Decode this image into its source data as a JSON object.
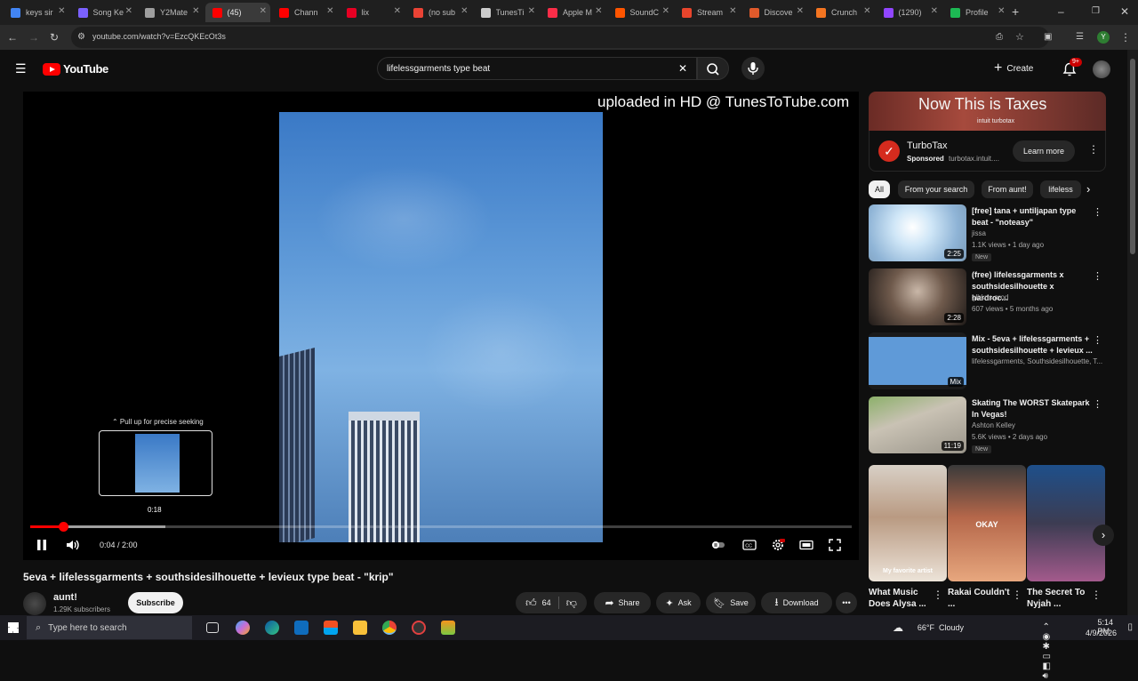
{
  "browser": {
    "tabs": [
      {
        "label": "keys sir",
        "color": "#4285f4"
      },
      {
        "label": "Song Ke",
        "color": "#7b61ff"
      },
      {
        "label": "Y2Mate",
        "color": "#9e9e9e"
      },
      {
        "label": "(45)",
        "color": "#ff0000"
      },
      {
        "label": "Chann",
        "color": "#ff0000"
      },
      {
        "label": "lix",
        "color": "#e60023"
      },
      {
        "label": "(no sub",
        "color": "#ea4335"
      },
      {
        "label": "TunesTi",
        "color": "#cccccc"
      },
      {
        "label": "Apple M",
        "color": "#fa2d48"
      },
      {
        "label": "SoundC",
        "color": "#ff5500"
      },
      {
        "label": "Stream",
        "color": "#e8452c"
      },
      {
        "label": "Discove",
        "color": "#e05a2b"
      },
      {
        "label": "Crunch",
        "color": "#f47521"
      },
      {
        "label": "(1290)",
        "color": "#9146ff"
      },
      {
        "label": "Profile",
        "color": "#1db954"
      }
    ],
    "active_tab_index": 3,
    "new_tab_symbol": "+",
    "url": "youtube.com/watch?v=EzcQKEcOt3s",
    "profile_initial": "Y"
  },
  "youtube": {
    "logo_text": "YouTube",
    "search_query": "lifelessgarments type beat",
    "create_label": "Create",
    "notification_count": "9+"
  },
  "player": {
    "watermark": "uploaded in HD @ TunesToTube.com",
    "seek_hint": "⌃ Pull up for precise seeking",
    "hover_time": "0:18",
    "current_time": "0:04",
    "duration": "2:00",
    "time_separator": " / ",
    "played_fraction": 0.04,
    "buffered_fraction": 0.165
  },
  "video": {
    "title": "5eva + lifelessgarments + southsidesilhouette + levieux type beat - \"krip\"",
    "channel_name": "aunt!",
    "subscribers": "1.29K subscribers",
    "subscribe_label": "Subscribe",
    "like_count": "64",
    "share_label": "Share",
    "ask_label": "Ask",
    "save_label": "Save",
    "download_label": "Download"
  },
  "ad": {
    "headline": "Now This is Taxes",
    "brand_small": "intuit turbotax",
    "advertiser": "TurboTax",
    "sponsored_label": "Sponsored",
    "sponsor_domain": "turbotax.intuit....",
    "cta_label": "Learn more"
  },
  "filter_chips": [
    "All",
    "From your search",
    "From aunt!",
    "lifeless"
  ],
  "recommendations": [
    {
      "title": "[free] tana + untiljapan type beat - \"noteasy\"",
      "channel": "jissa",
      "meta": "1.1K views • 1 day ago",
      "duration": "2:25",
      "badge": "New"
    },
    {
      "title": "(free) lifelessgarments x southsidesilhouette x hardroc...",
      "channel": "glbkns prod",
      "meta": "607 views • 5 months ago",
      "duration": "2:28",
      "badge": ""
    },
    {
      "title": "Mix - 5eva + lifelessgarments + southsidesilhouette + levieux ...",
      "channel": "lifelessgarments, Southsidesilhouette, T...",
      "meta": "",
      "duration": "Mix",
      "badge": ""
    },
    {
      "title": "Skating The WORST Skatepark In Vegas!",
      "channel": "Ashton Kelley",
      "meta": "5.6K views • 2 days ago",
      "duration": "11:19",
      "badge": "New"
    }
  ],
  "shorts": [
    {
      "title": "What Music Does Alysa ...",
      "overlay": "My favorite artist"
    },
    {
      "title": "Rakai Couldn't ...",
      "overlay": "OKAY"
    },
    {
      "title": "The Secret To Nyjah ...",
      "overlay": ""
    }
  ],
  "taskbar": {
    "search_placeholder": "Type here to search",
    "weather": "66°F  Cloudy",
    "time": "5:14 PM",
    "date": "4/9/2026"
  }
}
